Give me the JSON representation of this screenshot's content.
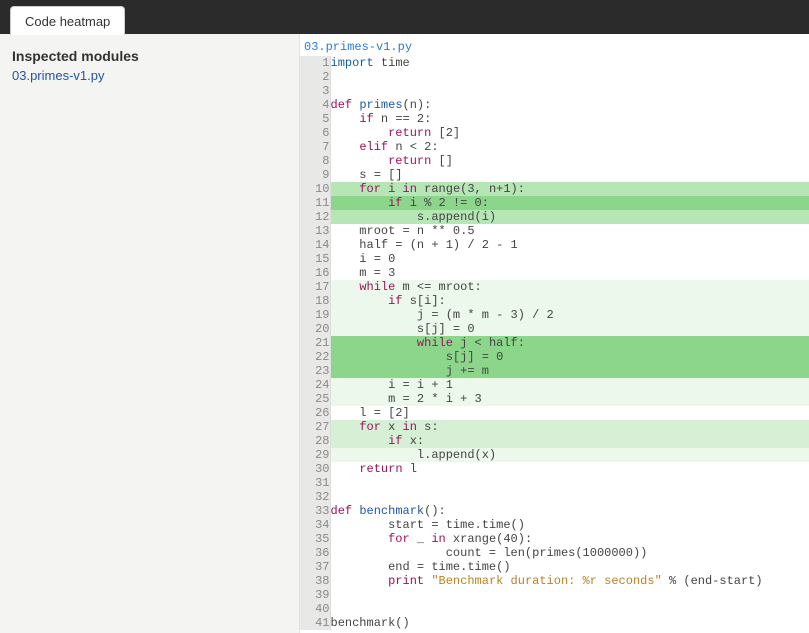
{
  "tab_label": "Code heatmap",
  "sidebar": {
    "heading": "Inspected modules",
    "modules": [
      "03.primes-v1.py"
    ]
  },
  "file": {
    "name": "03.primes-v1.py",
    "lines": [
      {
        "n": 1,
        "heat": 0,
        "tokens": [
          [
            "kw2",
            "import"
          ],
          [
            "plain",
            " time"
          ]
        ]
      },
      {
        "n": 2,
        "heat": 0,
        "tokens": [
          [
            "plain",
            ""
          ]
        ]
      },
      {
        "n": 3,
        "heat": 0,
        "tokens": [
          [
            "plain",
            ""
          ]
        ]
      },
      {
        "n": 4,
        "heat": 0,
        "tokens": [
          [
            "kw",
            "def"
          ],
          [
            "plain",
            " "
          ],
          [
            "nm",
            "primes"
          ],
          [
            "plain",
            "(n):"
          ]
        ]
      },
      {
        "n": 5,
        "heat": 0,
        "tokens": [
          [
            "plain",
            "    "
          ],
          [
            "kw",
            "if"
          ],
          [
            "plain",
            " n == 2:"
          ]
        ]
      },
      {
        "n": 6,
        "heat": 0,
        "tokens": [
          [
            "plain",
            "        "
          ],
          [
            "kw",
            "return"
          ],
          [
            "plain",
            " [2]"
          ]
        ]
      },
      {
        "n": 7,
        "heat": 0,
        "tokens": [
          [
            "plain",
            "    "
          ],
          [
            "kw",
            "elif"
          ],
          [
            "plain",
            " n < 2:"
          ]
        ]
      },
      {
        "n": 8,
        "heat": 0,
        "tokens": [
          [
            "plain",
            "        "
          ],
          [
            "kw",
            "return"
          ],
          [
            "plain",
            " []"
          ]
        ]
      },
      {
        "n": 9,
        "heat": 0,
        "tokens": [
          [
            "plain",
            "    s = []"
          ]
        ]
      },
      {
        "n": 10,
        "heat": 3,
        "tokens": [
          [
            "plain",
            "    "
          ],
          [
            "kw",
            "for"
          ],
          [
            "plain",
            " i "
          ],
          [
            "kw",
            "in"
          ],
          [
            "plain",
            " range(3, n+1):"
          ]
        ]
      },
      {
        "n": 11,
        "heat": 4,
        "tokens": [
          [
            "plain",
            "        "
          ],
          [
            "kw",
            "if"
          ],
          [
            "plain",
            " i % 2 != 0:"
          ]
        ]
      },
      {
        "n": 12,
        "heat": 3,
        "tokens": [
          [
            "plain",
            "            s.append(i)"
          ]
        ]
      },
      {
        "n": 13,
        "heat": 0,
        "tokens": [
          [
            "plain",
            "    mroot = n ** 0.5"
          ]
        ]
      },
      {
        "n": 14,
        "heat": 0,
        "tokens": [
          [
            "plain",
            "    half = (n + 1) / 2 - 1"
          ]
        ]
      },
      {
        "n": 15,
        "heat": 0,
        "tokens": [
          [
            "plain",
            "    i = 0"
          ]
        ]
      },
      {
        "n": 16,
        "heat": 0,
        "tokens": [
          [
            "plain",
            "    m = 3"
          ]
        ]
      },
      {
        "n": 17,
        "heat": 1,
        "tokens": [
          [
            "plain",
            "    "
          ],
          [
            "kw",
            "while"
          ],
          [
            "plain",
            " m <= mroot:"
          ]
        ]
      },
      {
        "n": 18,
        "heat": 1,
        "tokens": [
          [
            "plain",
            "        "
          ],
          [
            "kw",
            "if"
          ],
          [
            "plain",
            " s[i]:"
          ]
        ]
      },
      {
        "n": 19,
        "heat": 1,
        "tokens": [
          [
            "plain",
            "            j = (m * m - 3) / 2"
          ]
        ]
      },
      {
        "n": 20,
        "heat": 1,
        "tokens": [
          [
            "plain",
            "            s[j] = 0"
          ]
        ]
      },
      {
        "n": 21,
        "heat": 4,
        "tokens": [
          [
            "plain",
            "            "
          ],
          [
            "kw",
            "while"
          ],
          [
            "plain",
            " j < half:"
          ]
        ]
      },
      {
        "n": 22,
        "heat": 4,
        "tokens": [
          [
            "plain",
            "                s[j] = 0"
          ]
        ]
      },
      {
        "n": 23,
        "heat": 4,
        "tokens": [
          [
            "plain",
            "                j += m"
          ]
        ]
      },
      {
        "n": 24,
        "heat": 1,
        "tokens": [
          [
            "plain",
            "        i = i + 1"
          ]
        ]
      },
      {
        "n": 25,
        "heat": 1,
        "tokens": [
          [
            "plain",
            "        m = 2 * i + 3"
          ]
        ]
      },
      {
        "n": 26,
        "heat": 0,
        "tokens": [
          [
            "plain",
            "    l = [2]"
          ]
        ]
      },
      {
        "n": 27,
        "heat": 2,
        "tokens": [
          [
            "plain",
            "    "
          ],
          [
            "kw",
            "for"
          ],
          [
            "plain",
            " x "
          ],
          [
            "kw",
            "in"
          ],
          [
            "plain",
            " s:"
          ]
        ]
      },
      {
        "n": 28,
        "heat": 2,
        "tokens": [
          [
            "plain",
            "        "
          ],
          [
            "kw",
            "if"
          ],
          [
            "plain",
            " x:"
          ]
        ]
      },
      {
        "n": 29,
        "heat": 1,
        "tokens": [
          [
            "plain",
            "            l.append(x)"
          ]
        ]
      },
      {
        "n": 30,
        "heat": 0,
        "tokens": [
          [
            "plain",
            "    "
          ],
          [
            "kw",
            "return"
          ],
          [
            "plain",
            " l"
          ]
        ]
      },
      {
        "n": 31,
        "heat": 0,
        "tokens": [
          [
            "plain",
            ""
          ]
        ]
      },
      {
        "n": 32,
        "heat": 0,
        "tokens": [
          [
            "plain",
            ""
          ]
        ]
      },
      {
        "n": 33,
        "heat": 0,
        "tokens": [
          [
            "kw",
            "def"
          ],
          [
            "plain",
            " "
          ],
          [
            "nm",
            "benchmark"
          ],
          [
            "plain",
            "():"
          ]
        ]
      },
      {
        "n": 34,
        "heat": 0,
        "tokens": [
          [
            "plain",
            "        start = time.time()"
          ]
        ]
      },
      {
        "n": 35,
        "heat": 0,
        "tokens": [
          [
            "plain",
            "        "
          ],
          [
            "kw",
            "for"
          ],
          [
            "plain",
            " _ "
          ],
          [
            "kw",
            "in"
          ],
          [
            "plain",
            " xrange(40):"
          ]
        ]
      },
      {
        "n": 36,
        "heat": 0,
        "tokens": [
          [
            "plain",
            "                count = len(primes(1000000))"
          ]
        ]
      },
      {
        "n": 37,
        "heat": 0,
        "tokens": [
          [
            "plain",
            "        end = time.time()"
          ]
        ]
      },
      {
        "n": 38,
        "heat": 0,
        "tokens": [
          [
            "plain",
            "        "
          ],
          [
            "kw",
            "print"
          ],
          [
            "plain",
            " "
          ],
          [
            "str",
            "\"Benchmark duration: %r seconds\""
          ],
          [
            "plain",
            " % (end-start)"
          ]
        ]
      },
      {
        "n": 39,
        "heat": 0,
        "tokens": [
          [
            "plain",
            ""
          ]
        ]
      },
      {
        "n": 40,
        "heat": 0,
        "tokens": [
          [
            "plain",
            ""
          ]
        ]
      },
      {
        "n": 41,
        "heat": 0,
        "tokens": [
          [
            "plain",
            "benchmark()"
          ]
        ]
      }
    ]
  }
}
